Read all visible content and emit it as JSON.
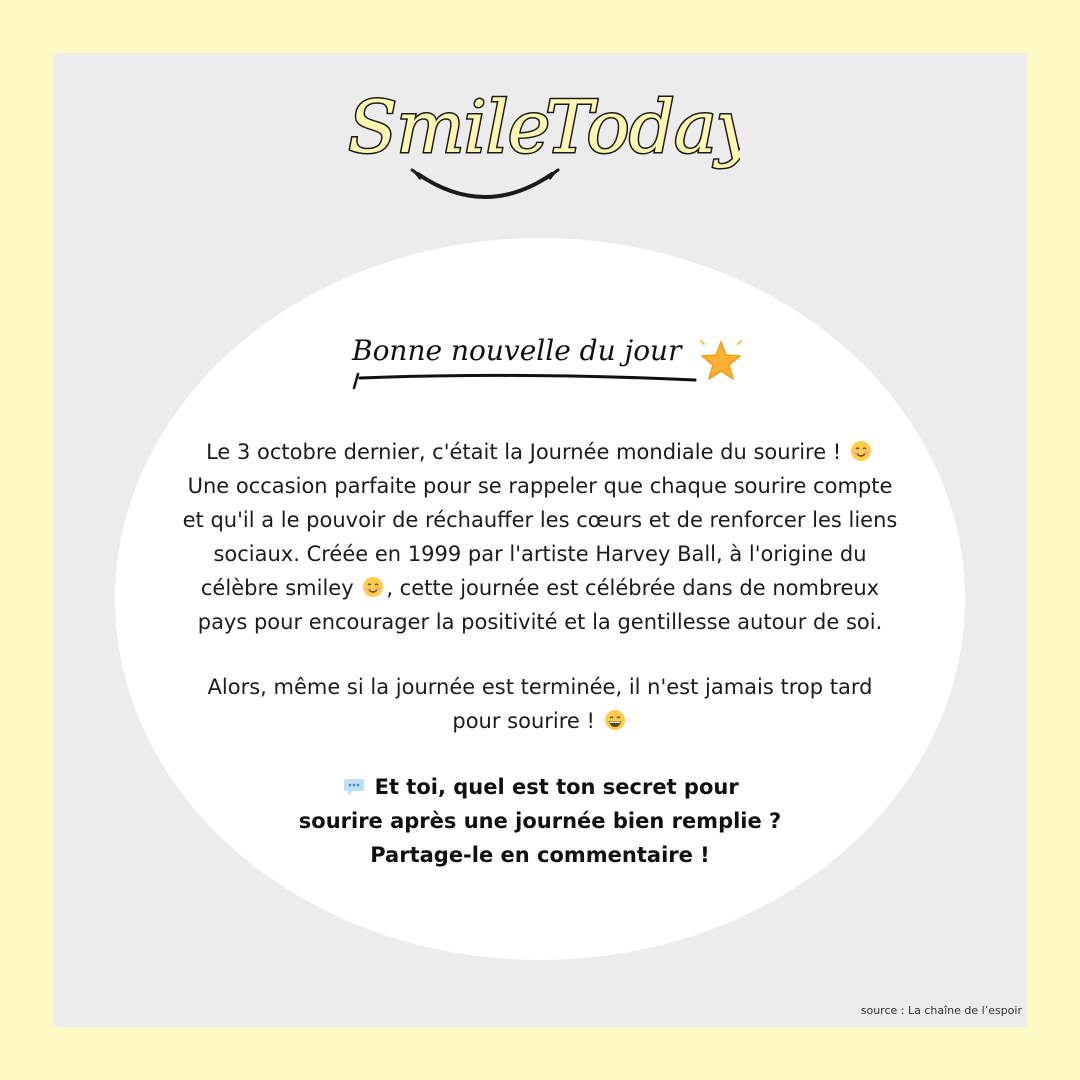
{
  "logo": {
    "text_smile": "Smile",
    "text_today": "Today"
  },
  "headline": "Bonne nouvelle du jour",
  "paragraph1": {
    "line1": "Le 3 octobre dernier, c'était la Journée mondiale du sourire !",
    "line2": "Une occasion parfaite pour se rappeler que chaque sourire compte",
    "line3": "et qu'il a le pouvoir de réchauffer les cœurs et de renforcer les liens",
    "line4": "sociaux. Créée en 1999 par l'artiste Harvey Ball, à l'origine du",
    "line5a": "célèbre smiley",
    "line5b": ", cette journée est célébrée dans de nombreux",
    "line6": "pays pour encourager la positivité et la gentillesse autour de soi."
  },
  "paragraph2": {
    "line1": "Alors, même si la journée est terminée, il n'est jamais trop tard",
    "line2": "pour sourire !"
  },
  "paragraph3": {
    "line1": "Et toi, quel est ton secret pour",
    "line2": "sourire après une journée bien remplie ?",
    "line3": "Partage-le en commentaire !"
  },
  "source": "source : La chaîne de l’espoir",
  "icons": {
    "star": "star-icon",
    "smile_blush": "smiling-face-icon",
    "grin": "grinning-face-icon",
    "speech": "speech-bubble-icon"
  },
  "colors": {
    "background": "#fff9c4",
    "panel": "#ececec",
    "ellipse": "#ffffff",
    "logo_fill": "#fff6b0"
  }
}
